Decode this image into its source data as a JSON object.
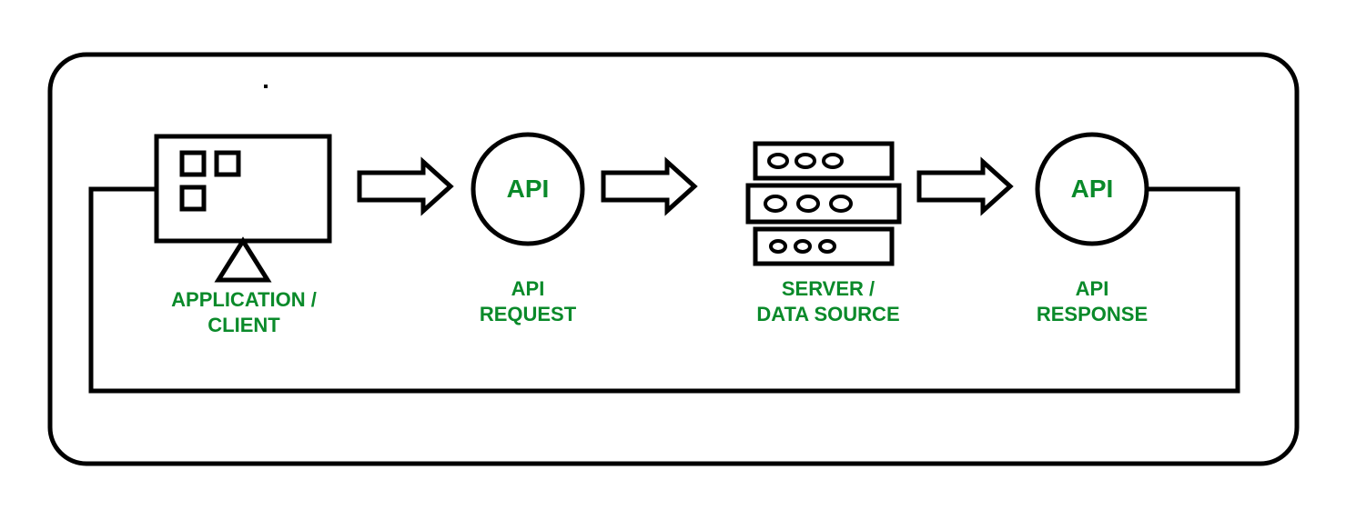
{
  "diagram": {
    "nodes": {
      "client": {
        "label": "APPLICATION /\nCLIENT"
      },
      "api_request": {
        "circle_label": "API",
        "label": "API\nREQUEST"
      },
      "server": {
        "label": "SERVER /\nDATA SOURCE"
      },
      "api_response": {
        "circle_label": "API",
        "label": "API\nRESPONSE"
      }
    },
    "flow": [
      "client",
      "api_request",
      "server",
      "api_response",
      "client"
    ],
    "colors": {
      "stroke": "#000000",
      "text": "#0a8a2a"
    }
  }
}
